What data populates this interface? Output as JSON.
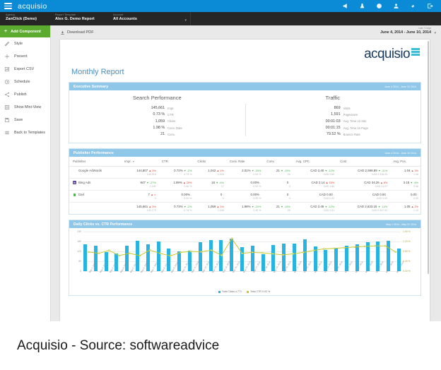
{
  "topbar": {
    "brand": "acquisio",
    "menu_icon": "hamburger-icon",
    "icons": [
      "megaphone-icon",
      "flask-icon",
      "help-icon",
      "user-icon",
      "link-icon",
      "logout-icon"
    ]
  },
  "subbar": {
    "fields": [
      {
        "label": "Agency",
        "value": "ZanClick (Demo)"
      },
      {
        "label": "Report Template",
        "value": "Alex G. Demo Report"
      },
      {
        "label": "Account",
        "value": "All Accounts"
      }
    ],
    "caret": "▾"
  },
  "sidebar": {
    "add_component": "Add Component",
    "items": [
      {
        "label": "Style",
        "icon": "pencil-icon"
      },
      {
        "label": "Present",
        "icon": "play-icon"
      },
      {
        "label": "Export CSV",
        "icon": "export-icon"
      },
      {
        "label": "Schedule",
        "icon": "clock-icon"
      },
      {
        "label": "Publish",
        "icon": "share-icon"
      },
      {
        "label": "Show Mini-View",
        "icon": "grid-icon"
      },
      {
        "label": "Save",
        "icon": "save-icon"
      },
      {
        "label": "Back to Templates",
        "icon": "list-icon"
      }
    ]
  },
  "canvas": {
    "download_pdf": "Download PDF",
    "date_label": "Last 7 Days",
    "date_value": "June 4, 2014 - June 10, 2014"
  },
  "report": {
    "logo": "acquisio",
    "title": "Monthly Report"
  },
  "executive_summary": {
    "heading": "Executive Summary",
    "date_range": "June 4 2014 - June 10 2014",
    "search": {
      "heading": "Search Performance",
      "rows": [
        {
          "value": "145,661",
          "key": "Impr."
        },
        {
          "value": "0.73 %",
          "key": "CTR"
        },
        {
          "value": "1,059",
          "key": "Clicks"
        },
        {
          "value": "1.98 %",
          "key": "Conv. Rate"
        },
        {
          "value": "21",
          "key": "Conv."
        }
      ]
    },
    "traffic": {
      "heading": "Traffic",
      "rows": [
        {
          "value": "869",
          "key": "Visits"
        },
        {
          "value": "1,591",
          "key": "Pageviews"
        },
        {
          "value": "00:01:03",
          "key": "Avg. Time on Site"
        },
        {
          "value": "00:01:15",
          "key": "Avg. Time on Page"
        },
        {
          "value": "79.52 %",
          "key": "Bounce Rate"
        }
      ]
    }
  },
  "publisher_performance": {
    "heading": "Publisher Performance",
    "date_range": "June 4 2014 - June 10 2014",
    "columns": [
      "Publisher",
      "Impr.",
      "CTR",
      "Clicks",
      "Conv. Rate",
      "Conv.",
      "Avg. CPC",
      "Cost",
      "Avg. Pos."
    ],
    "sorted_column": "Impr.",
    "rows": [
      {
        "publisher": "Google AdWords",
        "badge": "google-icon",
        "cells": [
          {
            "main": "144,807",
            "delta": "3%",
            "dir": "up",
            "sub": "140,018"
          },
          {
            "main": "0.72%",
            "delta": "-2%",
            "dir": "down",
            "sub": "0.73 %"
          },
          {
            "main": "1,042",
            "delta": "1%",
            "dir": "up",
            "sub": "1,028"
          },
          {
            "main": "2.01%",
            "delta": "-20%",
            "dir": "down",
            "sub": "2.53 %"
          },
          {
            "main": "21",
            "delta": "-19%",
            "dir": "down",
            "sub": "26"
          },
          {
            "main": "CAD 2.40",
            "delta": "-12%",
            "dir": "down",
            "sub": "CAD 2.80"
          },
          {
            "main": "CAD 2,598.89",
            "delta": "-11%",
            "dir": "down",
            "sub": "CAD 2,916.00"
          },
          {
            "main": "1.04",
            "delta": "3%",
            "dir": "up",
            "sub": "1.08"
          }
        ]
      },
      {
        "publisher": "Bing Ads",
        "badge": "bing-icon",
        "cells": [
          {
            "main": "847",
            "delta": "-27%",
            "dir": "down",
            "sub": "1,161"
          },
          {
            "main": "1.89%",
            "delta": "29%",
            "dir": "up",
            "sub": "1.46 %"
          },
          {
            "main": "16",
            "delta": "-6%",
            "dir": "down",
            "sub": "17"
          },
          {
            "main": "0.00%",
            "delta": "-",
            "dir": "flat",
            "sub": "0.00 %"
          },
          {
            "main": "0",
            "delta": "-",
            "dir": "flat",
            "sub": "0"
          },
          {
            "main": "CAD 2.14",
            "delta": "15%",
            "dir": "up",
            "sub": "CAD 1.86"
          },
          {
            "main": "CAD 34.26",
            "delta": "8%",
            "dir": "up",
            "sub": "CAD 31.57"
          },
          {
            "main": "3.15",
            "delta": "-6%",
            "dir": "down",
            "sub": "3.46"
          }
        ]
      },
      {
        "publisher": "Dart",
        "badge": "dart-icon",
        "cells": [
          {
            "main": "7",
            "delta": "∞",
            "dir": "up",
            "sub": "0"
          },
          {
            "main": "0.00%",
            "delta": "-",
            "dir": "flat",
            "sub": "0.00 %"
          },
          {
            "main": "0",
            "delta": "-",
            "dir": "flat",
            "sub": "0"
          },
          {
            "main": "0.00%",
            "delta": "-",
            "dir": "flat",
            "sub": "0.00 %"
          },
          {
            "main": "0",
            "delta": "-",
            "dir": "flat",
            "sub": "0"
          },
          {
            "main": "CAD 0.00",
            "delta": "-",
            "dir": "flat",
            "sub": "CAD 0.00"
          },
          {
            "main": "CAD 0.00",
            "delta": "-",
            "dir": "flat",
            "sub": "CAD 0.00"
          },
          {
            "main": "0.00",
            "delta": "-",
            "dir": "flat",
            "sub": "0.00"
          }
        ]
      },
      {
        "publisher": "",
        "badge": "none",
        "total": true,
        "cells": [
          {
            "main": "145,661",
            "delta": "3%",
            "dir": "up",
            "sub": "141,179"
          },
          {
            "main": "0.73%",
            "delta": "-2%",
            "dir": "down",
            "sub": "0.74 %"
          },
          {
            "main": "1,059",
            "delta": "1%",
            "dir": "up",
            "sub": "1,046"
          },
          {
            "main": "1.98%",
            "delta": "-20%",
            "dir": "down",
            "sub": "2.49 %"
          },
          {
            "main": "21",
            "delta": "-19%",
            "dir": "down",
            "sub": "26"
          },
          {
            "main": "CAD 2.49",
            "delta": "-12%",
            "dir": "down",
            "sub": "CAD 2.81"
          },
          {
            "main": "CAD 2,633.15",
            "delta": "-10%",
            "dir": "down",
            "sub": "CAD 2,947.62"
          },
          {
            "main": "1.05",
            "delta": "2%",
            "dir": "up",
            "sub": "1.10"
          }
        ]
      }
    ]
  },
  "chart_panel": {
    "heading": "Daily Clicks vs. CTR Performance",
    "date_range": "May 1 2014 - May 31 2014"
  },
  "chart_data": {
    "type": "bar",
    "title": "Daily Clicks vs. CTR Performance",
    "xlabel": "",
    "ylabel": "Clicks",
    "y2label": "CTR",
    "ylim": [
      0,
      240
    ],
    "y2lim": [
      0,
      1.6
    ],
    "yticks": [
      "0",
      "60",
      "120",
      "180",
      "240"
    ],
    "y2ticks": [
      "0.00 %",
      "0.40 %",
      "0.80 %",
      "1.20 %",
      "1.60 %"
    ],
    "grid": true,
    "legend_position": "bottom",
    "categories": [
      "May 1, 2014",
      "May 2, 2014",
      "May 3, 2014",
      "May 4, 2014",
      "May 5, 2014",
      "May 6, 2014",
      "May 7, 2014",
      "May 8, 2014",
      "May 9, 2014",
      "May 10, 2014",
      "May 11, 2014",
      "May 12, 2014",
      "May 13, 2014",
      "May 14, 2014",
      "May 15, 2014",
      "May 16, 2014",
      "May 17, 2014",
      "May 18, 2014",
      "May 19, 2014",
      "May 20, 2014",
      "May 21, 2014",
      "May 22, 2014",
      "May 23, 2014",
      "May 24, 2014",
      "May 25, 2014",
      "May 26, 2014",
      "May 27, 2014",
      "May 28, 2014",
      "May 29, 2014",
      "May 30, 2014",
      "May 31, 2014"
    ],
    "series": [
      {
        "name": "Total Clicks",
        "type": "bar",
        "color": "#29b3e3",
        "axis": "left",
        "values": [
          163,
          155,
          117,
          108,
          158,
          186,
          164,
          182,
          138,
          120,
          128,
          178,
          189,
          192,
          200,
          146,
          156,
          104,
          160,
          168,
          170,
          196,
          152,
          131,
          143,
          156,
          164,
          176,
          180,
          186,
          140
        ]
      },
      {
        "name": "Total CTR",
        "type": "line",
        "color": "#c8c82e",
        "axis": "right",
        "values": [
          0.78,
          0.72,
          0.84,
          0.63,
          0.72,
          0.63,
          0.85,
          0.72,
          0.62,
          0.76,
          0.8,
          0.78,
          0.85,
          0.64,
          1.32,
          0.72,
          0.76,
          0.74,
          0.7,
          0.66,
          0.7,
          0.76,
          0.84,
          0.9,
          0.92,
          0.95,
          0.98,
          1.0,
          1.02,
          1.02,
          0.78
        ]
      }
    ],
    "legend": [
      {
        "label": "Total Clicks 4,771",
        "color": "#29b3e3"
      },
      {
        "label": "Total CTR 0.93 %",
        "color": "#c8c82e"
      }
    ]
  },
  "caption": "Acquisio - Source: softwareadvice"
}
